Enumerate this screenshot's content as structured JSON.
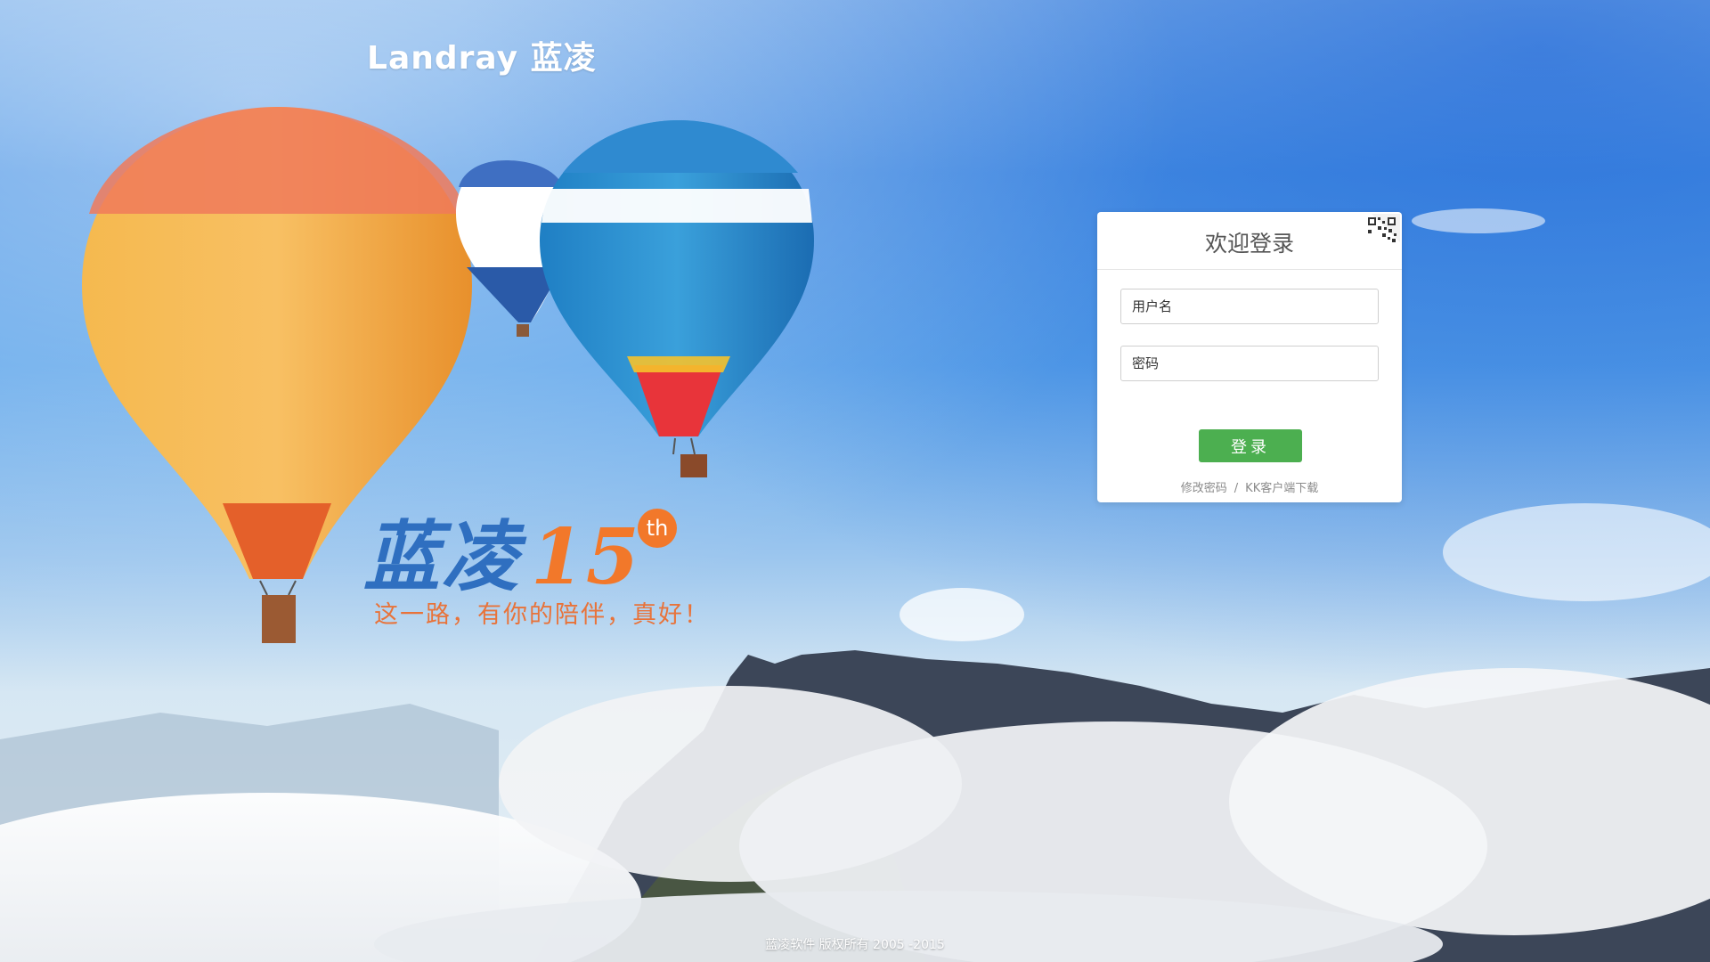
{
  "brand": {
    "logo_text": "Landray 蓝凌"
  },
  "slogan": {
    "title_text": "蓝凌",
    "title_number": "15",
    "superscript": "th",
    "subtitle": "这一路，有你的陪伴，真好！"
  },
  "login": {
    "title": "欢迎登录",
    "username_placeholder": "用户名",
    "password_placeholder": "密码",
    "submit_label": "登录",
    "change_password_link": "修改密码",
    "separator": "/",
    "kk_download_link": "KK客户端下载",
    "qr_icon": "qr-code-icon"
  },
  "footer": {
    "copyright": "蓝凌软件 版权所有 2005 -2015"
  },
  "colors": {
    "login_button": "#4caf50",
    "slogan_orange": "#f2782a",
    "slogan_blue": "#2f6fc0"
  }
}
